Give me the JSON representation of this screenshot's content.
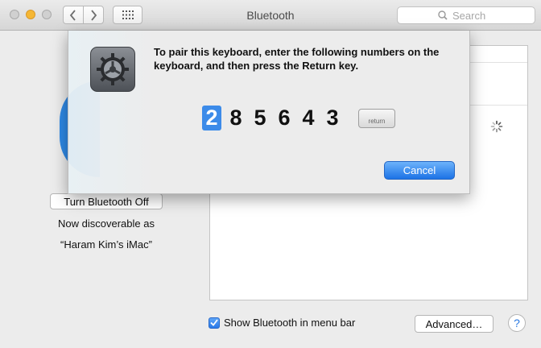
{
  "window": {
    "title": "Bluetooth"
  },
  "search": {
    "placeholder": "Search"
  },
  "bluetooth": {
    "toggle_label": "Turn Bluetooth Off",
    "discoverable_text": "Now discoverable as",
    "computer_name": "“Haram Kim’s iMac”"
  },
  "footer": {
    "show_in_menu_label": "Show Bluetooth in menu bar",
    "show_in_menu_checked": true,
    "advanced_label": "Advanced…",
    "help_label": "?"
  },
  "dialog": {
    "message": "To pair this keyboard, enter the following numbers on the keyboard, and then press the Return key.",
    "passkey_digits": [
      "2",
      "8",
      "5",
      "6",
      "4",
      "3"
    ],
    "active_digit_index": 0,
    "return_key_label": "return",
    "cancel_label": "Cancel"
  },
  "colors": {
    "accent": "#3c8be9",
    "bluetooth_blue": "#2f89e6"
  },
  "icons": [
    "back-chevron-icon",
    "forward-chevron-icon",
    "grid-icon",
    "search-icon",
    "system-preferences-gear-icon",
    "loading-spinner-icon",
    "checkmark-icon"
  ]
}
